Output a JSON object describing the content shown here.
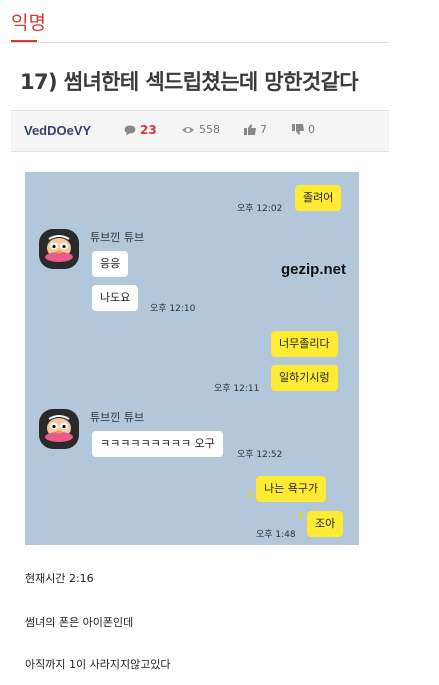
{
  "board": {
    "tab_label": "익명"
  },
  "post": {
    "title": "17) 썸녀한테 섹드립쳤는데 망한것같다",
    "author": "VedDOeVY",
    "comments": "23",
    "views": "558",
    "upvotes": "7",
    "downvotes": "0"
  },
  "icons": {
    "comments": "speech-bubble-icon",
    "views": "eye-icon",
    "upvote": "thumbs-up-icon",
    "downvote": "thumbs-down-icon"
  },
  "colors": {
    "accent": "#d33a3a",
    "chat_background": "#b2c7d9",
    "my_bubble": "#ffeb33",
    "other_bubble": "#ffffff"
  },
  "chat": {
    "watermark": "gezip.net",
    "sender_name": "튜브낀 튜브",
    "messages": [
      {
        "from": "me",
        "text": "졸려어",
        "time": "오후 12:02"
      },
      {
        "from": "other",
        "text": "응응",
        "time": ""
      },
      {
        "from": "other",
        "text": "나도요",
        "time": "오후 12:10"
      },
      {
        "from": "me",
        "text": "너무졸리다",
        "time": ""
      },
      {
        "from": "me",
        "text": "일하기시렁",
        "time": "오후 12:11"
      },
      {
        "from": "other",
        "text": "ㅋㅋㅋㅋㅋㅋㅋㅋㅋ 오구",
        "time": "오후 12:52"
      },
      {
        "from": "me",
        "text": "나는 욕구가",
        "time": "",
        "unread": "1"
      },
      {
        "from": "me",
        "text": "조아",
        "time": "오후 1:48",
        "unread": "1"
      }
    ]
  },
  "body_lines": [
    "현재시간 2:16",
    "썸녀의 폰은 아이폰인데",
    "아직까지 1이 사라지지않고있다"
  ]
}
